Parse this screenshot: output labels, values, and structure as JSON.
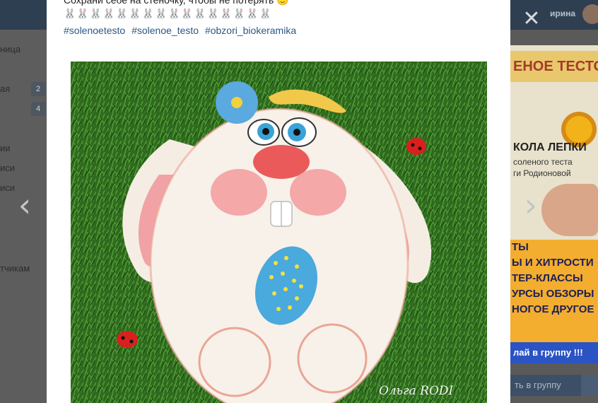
{
  "viewer": {
    "close_glyph": "✕",
    "prev_glyph": "‹",
    "next_glyph": "›"
  },
  "header": {
    "user_name": "ирина"
  },
  "post": {
    "text": "Сохрани себе на стеночку, чтобы не потерять 🙂",
    "emoji_row": "🐰🐰🐰🐰🐰🐰🐰🐰🐰🐰🐰🐰🐰🐰🐰🐰",
    "hashtags": [
      "#solenoetesto",
      "#solenoe_testo",
      "#obzori_biokeramika"
    ],
    "photo": {
      "watermark": "Ольга RODI"
    }
  },
  "left_sidebar": {
    "items": [
      "ница",
      "ая",
      "ии",
      "иси",
      "иси",
      "тчикам"
    ],
    "badges": [
      "2",
      "4"
    ]
  },
  "right_banner": {
    "title": "ЕНОЕ ТЕСТО",
    "school": "КОЛА ЛЕПКИ",
    "line1": "соленого теста",
    "line2": "ги Родионовой",
    "tagline": "ТЫ\nЫ И ХИТРОСТИ\nТЕР-КЛАССЫ\nУРСЫ ОБЗОРЫ\nНОГОЕ ДРУГОЕ",
    "cta": "лай в группу !!!",
    "join_button": "ть в группу"
  }
}
